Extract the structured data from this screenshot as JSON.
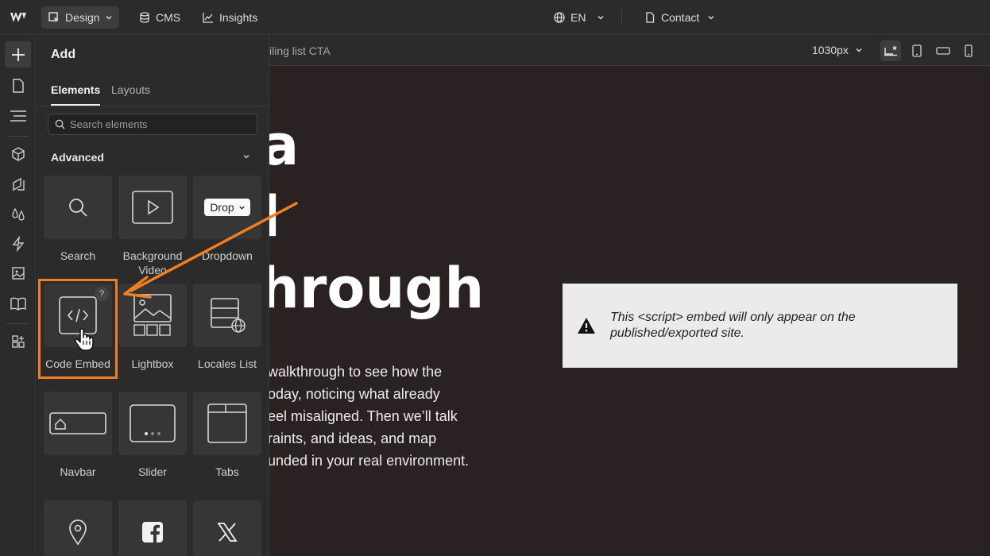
{
  "topbar": {
    "design_label": "Design",
    "cms_label": "CMS",
    "insights_label": "Insights",
    "locale_label": "EN",
    "page_label": "Contact"
  },
  "subbar": {
    "breadcrumb": "iling list CTA",
    "width_value": "1030px"
  },
  "panel": {
    "title": "Add",
    "tabs": [
      {
        "label": "Elements",
        "active": true
      },
      {
        "label": "Layouts",
        "active": false
      }
    ],
    "search_placeholder": "Search elements",
    "section_label": "Advanced",
    "tiles": [
      {
        "label": "Search",
        "icon": "search-icon"
      },
      {
        "label": "Background Video",
        "icon": "play-icon"
      },
      {
        "label": "Dropdown",
        "icon": "dropdown-icon",
        "pill_text": "Drop"
      },
      {
        "label": "Code Embed",
        "icon": "code-icon",
        "badge": "?"
      },
      {
        "label": "Lightbox",
        "icon": "lightbox-icon"
      },
      {
        "label": "Locales List",
        "icon": "locales-list-icon"
      },
      {
        "label": "Navbar",
        "icon": "navbar-icon"
      },
      {
        "label": "Slider",
        "icon": "slider-icon"
      },
      {
        "label": "Tabs",
        "icon": "tabs-icon"
      },
      {
        "label": "",
        "icon": "map-pin-icon"
      },
      {
        "label": "",
        "icon": "facebook-icon"
      },
      {
        "label": "",
        "icon": "x-logo-icon"
      }
    ]
  },
  "canvas": {
    "hero_lines": [
      "a",
      "l",
      "hrough"
    ],
    "paragraph": "walkthrough to see how the\noday, noticing what already\neel misaligned. Then we’ll talk\nraints, and ideas, and map\nunded in your real environment.",
    "notice_text": "This <script> embed will only appear on the\npublished/exported site."
  },
  "colors": {
    "highlight": "#f37e1f",
    "canvas_bg": "#2a2222",
    "panel_bg": "#2b2b2b"
  }
}
